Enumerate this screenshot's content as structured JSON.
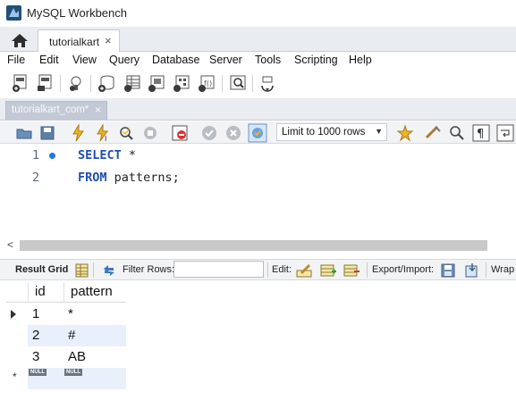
{
  "app": {
    "title": "MySQL Workbench",
    "icon": "workbench-dolphin-icon"
  },
  "connection_tabs": {
    "home_icon": "home-icon",
    "active": {
      "label": "tutorialkart",
      "close": "×"
    }
  },
  "menu": [
    "File",
    "Edit",
    "View",
    "Query",
    "Database",
    "Server",
    "Tools",
    "Scripting",
    "Help"
  ],
  "query_tab": {
    "label": "tutorialkart_com*",
    "close": "×"
  },
  "sql_toolbar": {
    "limit_label": "Limit to 1000 rows",
    "limit_arrow": "▼"
  },
  "editor": {
    "lines": [
      {
        "number": "1",
        "keyword": "SELECT",
        "rest": " *"
      },
      {
        "number": "2",
        "keyword": "FROM",
        "rest": " patterns;"
      }
    ]
  },
  "scrollbar": {
    "left_arrow": "<"
  },
  "results_toolbar": {
    "result_grid_label": "Result Grid",
    "filter_rows_label": "Filter Rows:",
    "filter_value": "",
    "edit_label": "Edit:",
    "export_label": "Export/Import:",
    "wrap_label": "Wrap"
  },
  "grid": {
    "columns": [
      "id",
      "pattern"
    ],
    "rows": [
      {
        "id": "1",
        "pattern": "*"
      },
      {
        "id": "2",
        "pattern": "#"
      },
      {
        "id": "3",
        "pattern": "AB"
      }
    ],
    "new_row": {
      "id": "NULL",
      "pattern": "NULL",
      "marker": "*"
    }
  },
  "colors": {
    "keyword": "#1f4fb5",
    "row_alt": "#e9f0fb",
    "tab_inactive": "#c3cad6",
    "line_marker": "#1f7ad6"
  }
}
